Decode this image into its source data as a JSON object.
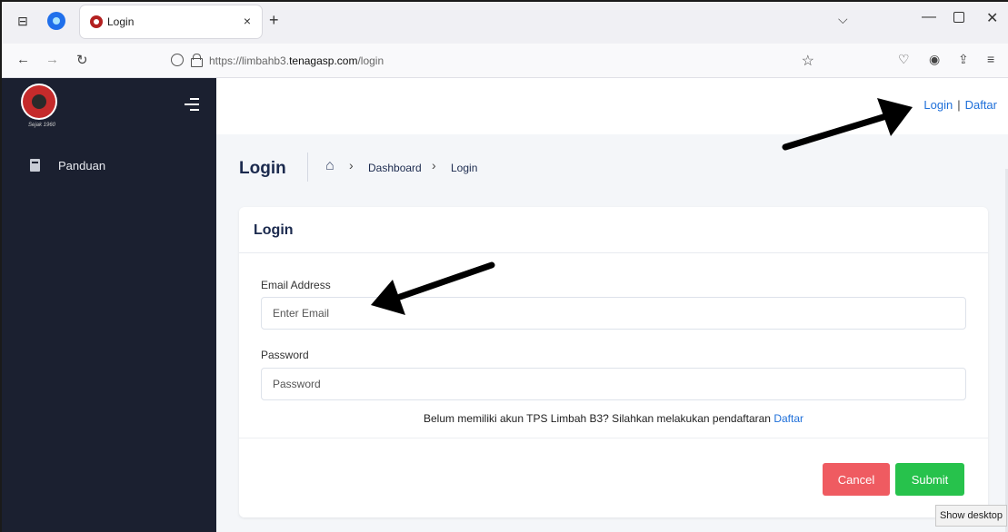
{
  "browser": {
    "tab_title": "Login",
    "url_prefix": "https://limbahb3.",
    "url_domain": "tenagasp.com",
    "url_path": "/login",
    "new_tab_label": "+",
    "tab_close_label": "×"
  },
  "sidebar": {
    "logo_caption": "Sejak 1960",
    "items": [
      {
        "label": "Panduan",
        "icon": "book-icon"
      }
    ]
  },
  "topbar": {
    "login_label": "Login",
    "separator": "|",
    "register_label": "Daftar"
  },
  "page": {
    "title": "Login",
    "breadcrumb": [
      "Dashboard",
      "Login"
    ]
  },
  "form": {
    "card_title": "Login",
    "email_label": "Email Address",
    "email_placeholder": "Enter Email",
    "password_label": "Password",
    "password_placeholder": "Password",
    "note_text": "Belum memiliki akun TPS Limbah B3? Silahkan melakukan pendaftaran",
    "note_link": "Daftar",
    "cancel_label": "Cancel",
    "submit_label": "Submit"
  },
  "colors": {
    "sidebar_bg": "#1b2030",
    "link": "#1e6fd9",
    "cancel": "#ef5b61",
    "submit": "#27c24c",
    "heading": "#1b2a4e"
  },
  "tooltip": "Show desktop"
}
